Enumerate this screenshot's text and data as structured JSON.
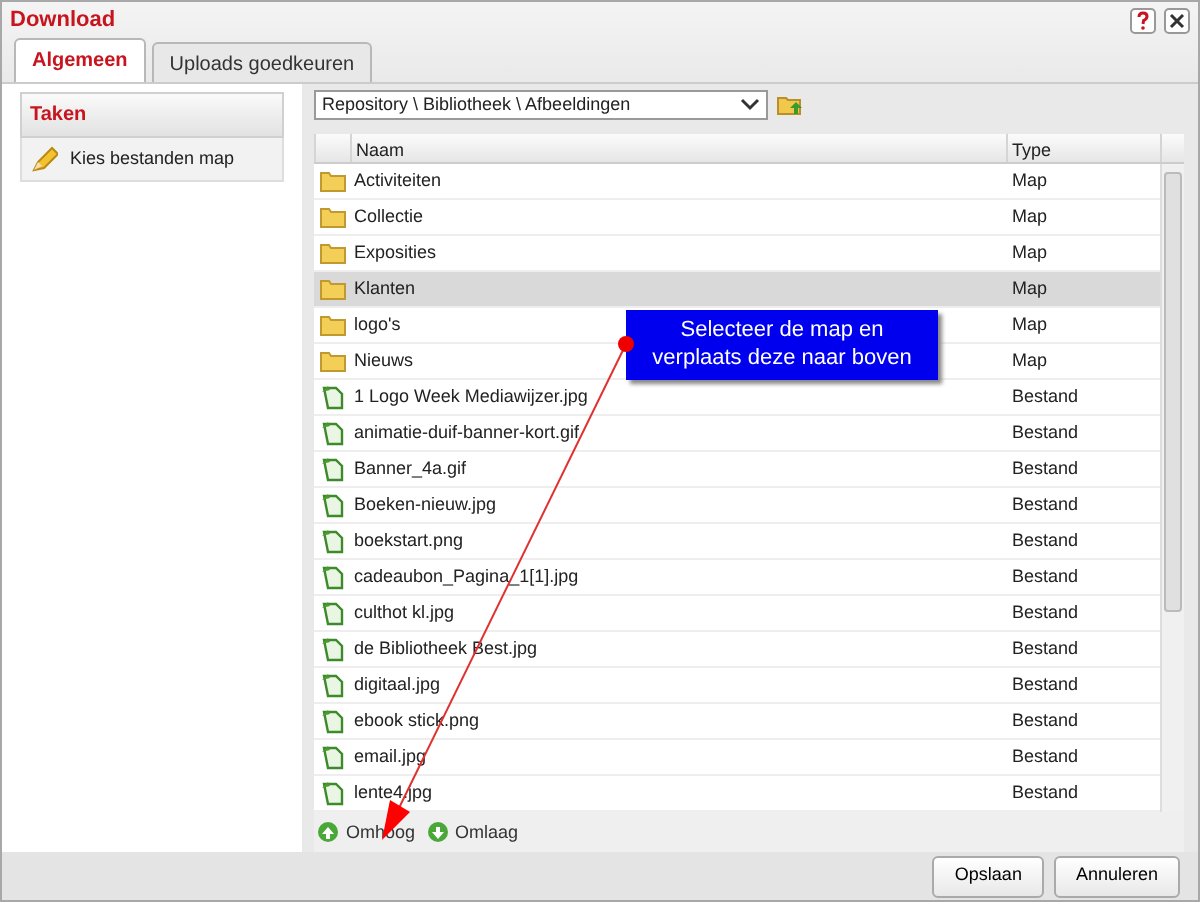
{
  "window": {
    "title": "Download"
  },
  "tabs": [
    {
      "label": "Algemeen",
      "selected": true
    },
    {
      "label": "Uploads goedkeuren",
      "selected": false
    }
  ],
  "sidebar": {
    "title": "Taken",
    "items": [
      {
        "label": "Kies bestanden map"
      }
    ]
  },
  "path": {
    "value": "Repository \\ Bibliotheek \\ Afbeeldingen"
  },
  "table": {
    "columns": [
      "Naam",
      "Type"
    ],
    "rows": [
      {
        "kind": "folder",
        "name": "Activiteiten",
        "type": "Map",
        "selected": false
      },
      {
        "kind": "folder",
        "name": "Collectie",
        "type": "Map",
        "selected": false
      },
      {
        "kind": "folder",
        "name": "Exposities",
        "type": "Map",
        "selected": false
      },
      {
        "kind": "folder",
        "name": "Klanten",
        "type": "Map",
        "selected": true
      },
      {
        "kind": "folder",
        "name": "logo's",
        "type": "Map",
        "selected": false
      },
      {
        "kind": "folder",
        "name": "Nieuws",
        "type": "Map",
        "selected": false
      },
      {
        "kind": "file",
        "name": "1 Logo Week Mediawijzer.jpg",
        "type": "Bestand",
        "selected": false
      },
      {
        "kind": "file",
        "name": "animatie-duif-banner-kort.gif",
        "type": "Bestand",
        "selected": false
      },
      {
        "kind": "file",
        "name": "Banner_4a.gif",
        "type": "Bestand",
        "selected": false
      },
      {
        "kind": "file",
        "name": "Boeken-nieuw.jpg",
        "type": "Bestand",
        "selected": false
      },
      {
        "kind": "file",
        "name": "boekstart.png",
        "type": "Bestand",
        "selected": false
      },
      {
        "kind": "file",
        "name": "cadeaubon_Pagina_1[1].jpg",
        "type": "Bestand",
        "selected": false
      },
      {
        "kind": "file",
        "name": "culthot kl.jpg",
        "type": "Bestand",
        "selected": false
      },
      {
        "kind": "file",
        "name": "de Bibliotheek Best.jpg",
        "type": "Bestand",
        "selected": false
      },
      {
        "kind": "file",
        "name": "digitaal.jpg",
        "type": "Bestand",
        "selected": false
      },
      {
        "kind": "file",
        "name": "ebook stick.png",
        "type": "Bestand",
        "selected": false
      },
      {
        "kind": "file",
        "name": "email.jpg",
        "type": "Bestand",
        "selected": false
      },
      {
        "kind": "file",
        "name": "lente4.jpg",
        "type": "Bestand",
        "selected": false
      }
    ]
  },
  "move_buttons": [
    {
      "kind": "up",
      "label": "Omhoog"
    },
    {
      "kind": "down",
      "label": "Omlaag"
    }
  ],
  "callout": {
    "lines": [
      "Selecteer de map en",
      "verplaats deze naar boven"
    ]
  },
  "buttons": [
    "Opslaan",
    "Annuleren"
  ]
}
